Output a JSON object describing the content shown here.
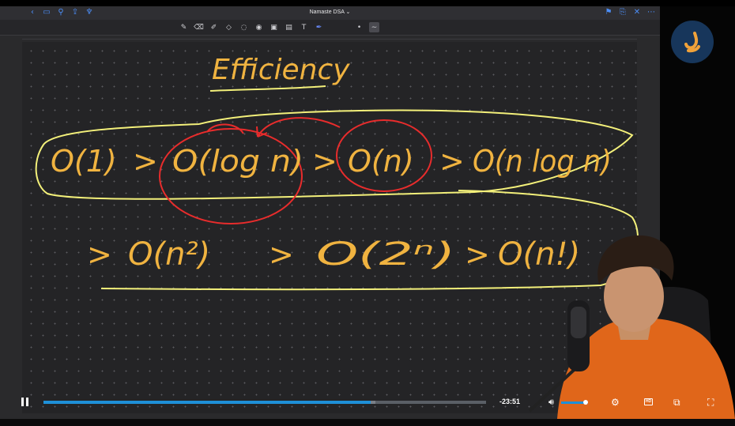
{
  "topbar": {
    "title": "Namaste DSA",
    "title_caret": "⌄",
    "left_icons": [
      "chevron-left-icon",
      "sidebar-icon",
      "search-icon",
      "share-icon",
      "microphone-icon"
    ],
    "right_icons": [
      "bookmark-icon",
      "new-page-icon",
      "close-icon",
      "more-icon"
    ]
  },
  "toolbar": {
    "tools": [
      "pen-icon",
      "eraser-icon",
      "highlighter-icon",
      "shapes-icon",
      "lasso-icon",
      "eye-icon",
      "image-icon",
      "camera-icon",
      "text-icon",
      "laser-pointer-icon",
      "dot-icon",
      "stroke-style-icon"
    ]
  },
  "whiteboard": {
    "heading": "Efficiency",
    "line1": [
      "O(1)",
      ">",
      "O(log n)",
      ">",
      "O(n)",
      ">",
      "O(n log n)"
    ],
    "line2": [
      ">",
      "O(n²)",
      ">",
      "O(2ⁿ)",
      ">",
      "O(n!)"
    ],
    "colors": {
      "ink": "#f0b340",
      "highlight": "#f3f07a",
      "circle": "#e82c2c"
    }
  },
  "player": {
    "time_remaining": "-23:51",
    "progress": 0.74,
    "buffered": 0.75,
    "volume": 0.9,
    "hd_label": "HD",
    "icons": [
      "pause-icon",
      "volume-icon",
      "settings-icon",
      "hd-icon",
      "picture-in-picture-icon",
      "fullscreen-icon"
    ],
    "accent": "#1e90d8"
  },
  "branding": {
    "logo_color": "#17365b",
    "logo_glyph_color": "#f0a23a"
  }
}
